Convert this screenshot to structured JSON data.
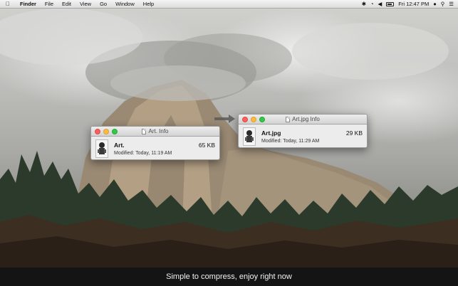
{
  "menubar": {
    "apple_icon": "apple-icon",
    "app_name": "Finder",
    "items": [
      "File",
      "Edit",
      "View",
      "Go",
      "Window",
      "Help"
    ],
    "clock": "Fri 12:47 PM"
  },
  "windows": {
    "original": {
      "title": "Art. Info",
      "file_name": "Art.",
      "file_size": "65 KB",
      "modified": "Modified: Today, 11:19 AM"
    },
    "compressed": {
      "title": "Art.jpg Info",
      "file_name": "Art.jpg",
      "file_size": "29 KB",
      "modified": "Modified: Today, 11:29 AM"
    }
  },
  "caption": "Simple to compress, enjoy right now",
  "colors": {
    "close": "#fc605c",
    "minimize": "#fdbc40",
    "zoom": "#34c84a",
    "caption_bg": "#141414"
  }
}
